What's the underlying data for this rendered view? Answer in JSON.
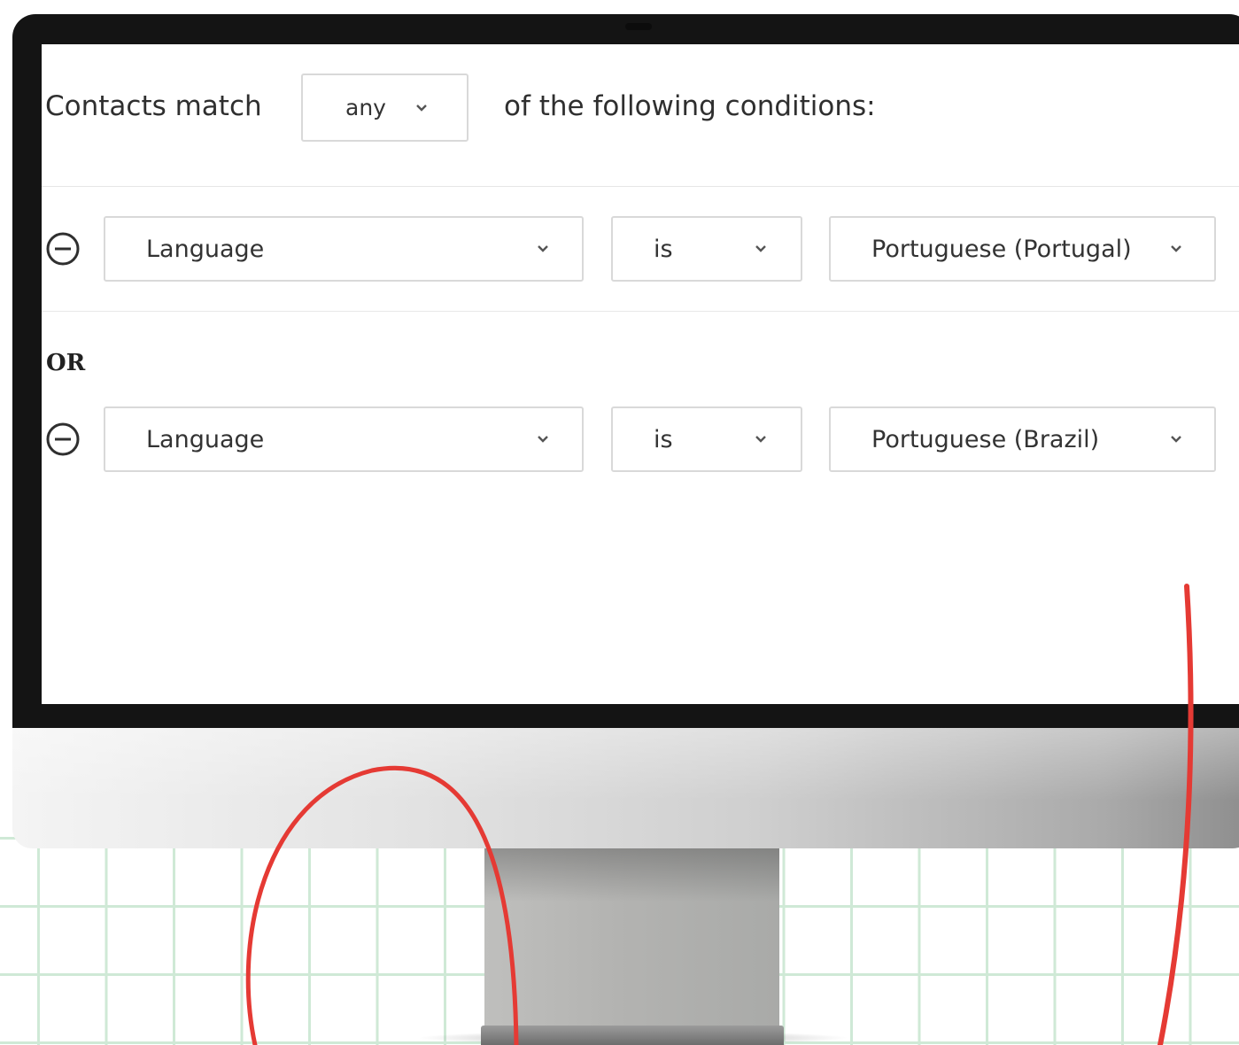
{
  "header": {
    "prefix": "Contacts match",
    "match_select": "any",
    "suffix": "of the following conditions:"
  },
  "connector": "OR",
  "conditions": [
    {
      "field": "Language",
      "operator": "is",
      "value": "Portuguese (Portugal)"
    },
    {
      "field": "Language",
      "operator": "is",
      "value": "Portuguese (Brazil)"
    }
  ],
  "icons": {
    "remove": "minus-circle-icon",
    "dropdown": "chevron-down-icon"
  },
  "colors": {
    "annotation": "#e53a34",
    "grid": "#cfe9d6"
  }
}
